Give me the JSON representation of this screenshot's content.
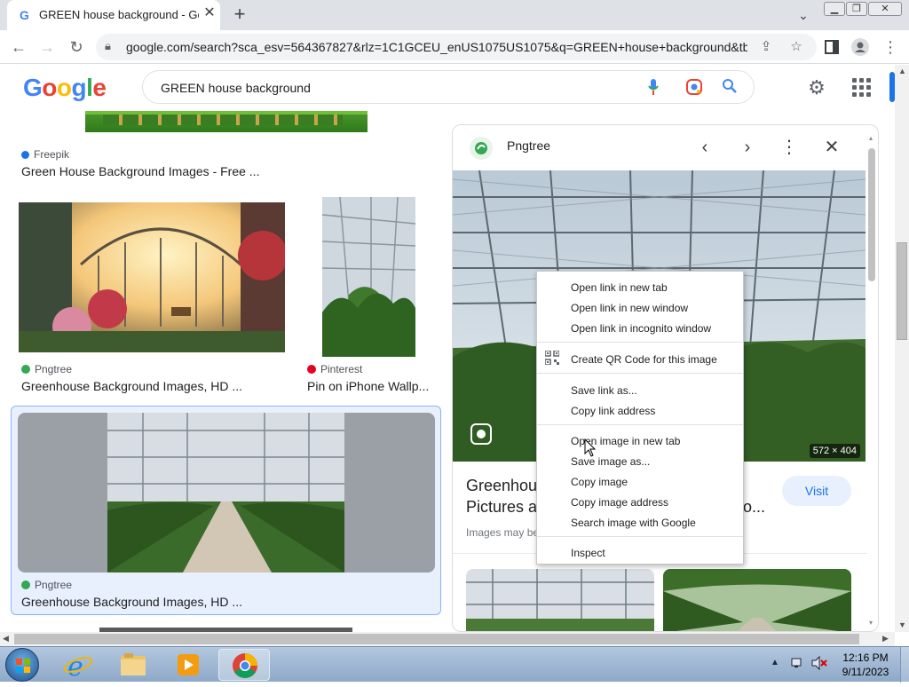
{
  "browser": {
    "tab_title": "GREEN house background - Goo",
    "favicon_letter": "G",
    "url": "google.com/search?sca_esv=564367827&rlz=1C1GCEU_enUS1075US1075&q=GREEN+house+background&tb...",
    "new_tab": "+",
    "close_tab": "✕"
  },
  "google": {
    "logo": [
      "G",
      "o",
      "o",
      "g",
      "l",
      "e"
    ],
    "logo_colors": [
      "#4285f4",
      "#ea4335",
      "#fbbc05",
      "#4285f4",
      "#34a853",
      "#ea4335"
    ],
    "query": "GREEN house background"
  },
  "results": [
    {
      "source": "Freepik",
      "title": "Green House Background Images - Free ...",
      "source_color": "#1a73e8"
    },
    {
      "source": "Pngtree",
      "title": "Greenhouse Background Images, HD ...",
      "source_color": "#34a853"
    },
    {
      "source": "Pinterest",
      "title": "Pin on iPhone Wallp...",
      "source_color": "#e60023"
    },
    {
      "source": "Pngtree",
      "title": "Greenhouse Background Images, HD ...",
      "source_color": "#34a853"
    }
  ],
  "panel": {
    "source": "Pngtree",
    "dimensions": "572 × 404",
    "title_line1": "Greenhou",
    "title_line2": "Pictures a",
    "title_tail": "o...",
    "subtitle": "Images may be",
    "visit": "Visit"
  },
  "context_menu": {
    "group1": [
      "Open link in new tab",
      "Open link in new window",
      "Open link in incognito window"
    ],
    "group2": [
      "Create QR Code for this image"
    ],
    "group3": [
      "Save link as...",
      "Copy link address"
    ],
    "group4": [
      "Open image in new tab",
      "Save image as...",
      "Copy image",
      "Copy image address",
      "Search image with Google"
    ],
    "group5": [
      "Inspect"
    ]
  },
  "taskbar": {
    "time": "12:16 PM",
    "date": "9/11/2023"
  }
}
